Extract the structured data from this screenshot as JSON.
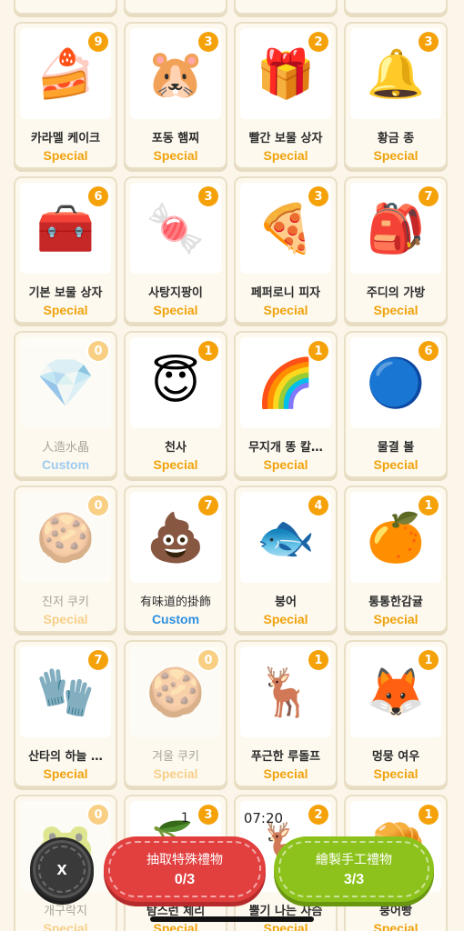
{
  "items": [
    {
      "name": "",
      "tag": "",
      "count": "",
      "icon": "",
      "state": "top"
    },
    {
      "name": "",
      "tag": "",
      "count": "",
      "icon": "",
      "state": "top"
    },
    {
      "name": "",
      "tag": "",
      "count": "",
      "icon": "",
      "state": "top"
    },
    {
      "name": "",
      "tag": "",
      "count": "",
      "icon": "",
      "state": "top"
    },
    {
      "name": "카라멜 케이크",
      "tag": "Special",
      "count": "9",
      "icon": "🍰",
      "state": "normal"
    },
    {
      "name": "포동 햄찌",
      "tag": "Special",
      "count": "3",
      "icon": "🐹",
      "state": "normal"
    },
    {
      "name": "빨간 보물 상자",
      "tag": "Special",
      "count": "2",
      "icon": "🎁",
      "state": "normal"
    },
    {
      "name": "황금 종",
      "tag": "Special",
      "count": "3",
      "icon": "🔔",
      "state": "normal"
    },
    {
      "name": "기본 보물 상자",
      "tag": "Special",
      "count": "6",
      "icon": "🧰",
      "state": "normal"
    },
    {
      "name": "사탕지팡이",
      "tag": "Special",
      "count": "3",
      "icon": "🍬",
      "state": "normal"
    },
    {
      "name": "페퍼로니 피자",
      "tag": "Special",
      "count": "3",
      "icon": "🍕",
      "state": "normal"
    },
    {
      "name": "주디의 가방",
      "tag": "Special",
      "count": "7",
      "icon": "🎒",
      "state": "normal"
    },
    {
      "name": "人造水晶",
      "tag": "Custom",
      "count": "0",
      "icon": "💎",
      "state": "dim"
    },
    {
      "name": "천사",
      "tag": "Special",
      "count": "1",
      "icon": "😇",
      "state": "normal"
    },
    {
      "name": "무지개 똥 칼…",
      "tag": "Special",
      "count": "1",
      "icon": "🌈",
      "state": "normal"
    },
    {
      "name": "물결 볼",
      "tag": "Special",
      "count": "6",
      "icon": "🔵",
      "state": "normal"
    },
    {
      "name": "진저 쿠키",
      "tag": "Special",
      "count": "0",
      "icon": "🍪",
      "state": "dim"
    },
    {
      "name": "有味道的掛飾",
      "tag": "Custom",
      "count": "7",
      "icon": "💩",
      "state": "plain"
    },
    {
      "name": "붕어",
      "tag": "Special",
      "count": "4",
      "icon": "🐟",
      "state": "normal"
    },
    {
      "name": "통통한감귤",
      "tag": "Special",
      "count": "1",
      "icon": "🍊",
      "state": "normal"
    },
    {
      "name": "산타의 하늘 …",
      "tag": "Special",
      "count": "7",
      "icon": "🧤",
      "state": "normal"
    },
    {
      "name": "겨울 쿠키",
      "tag": "Special",
      "count": "0",
      "icon": "🍪",
      "state": "dim"
    },
    {
      "name": "푸근한 루돌프",
      "tag": "Special",
      "count": "1",
      "icon": "🦌",
      "state": "normal"
    },
    {
      "name": "멍뭉 여우",
      "tag": "Special",
      "count": "1",
      "icon": "🦊",
      "state": "normal"
    },
    {
      "name": "개구락지",
      "tag": "Special",
      "count": "0",
      "icon": "🐸",
      "state": "dim"
    },
    {
      "name": "탐스런 체리",
      "tag": "Special",
      "count": "3",
      "icon": "🍒",
      "state": "normal"
    },
    {
      "name": "뿔기 나는 사슴",
      "tag": "Special",
      "count": "2",
      "icon": "🦌",
      "state": "normal"
    },
    {
      "name": "붕어빵",
      "tag": "Special",
      "count": "1",
      "icon": "🥐",
      "state": "normal"
    }
  ],
  "status": {
    "left": "1",
    "time": "07:20"
  },
  "actions": {
    "close_label": "x",
    "draw_label": "抽取特殊禮物",
    "draw_count": "0/3",
    "craft_label": "繪製手工禮物",
    "craft_count": "3/3"
  },
  "colors": {
    "special": "#f0a20c",
    "custom": "#2f8fe0",
    "badge": "#f5a20a",
    "draw": "#e23f3f",
    "craft": "#8cc21b"
  }
}
